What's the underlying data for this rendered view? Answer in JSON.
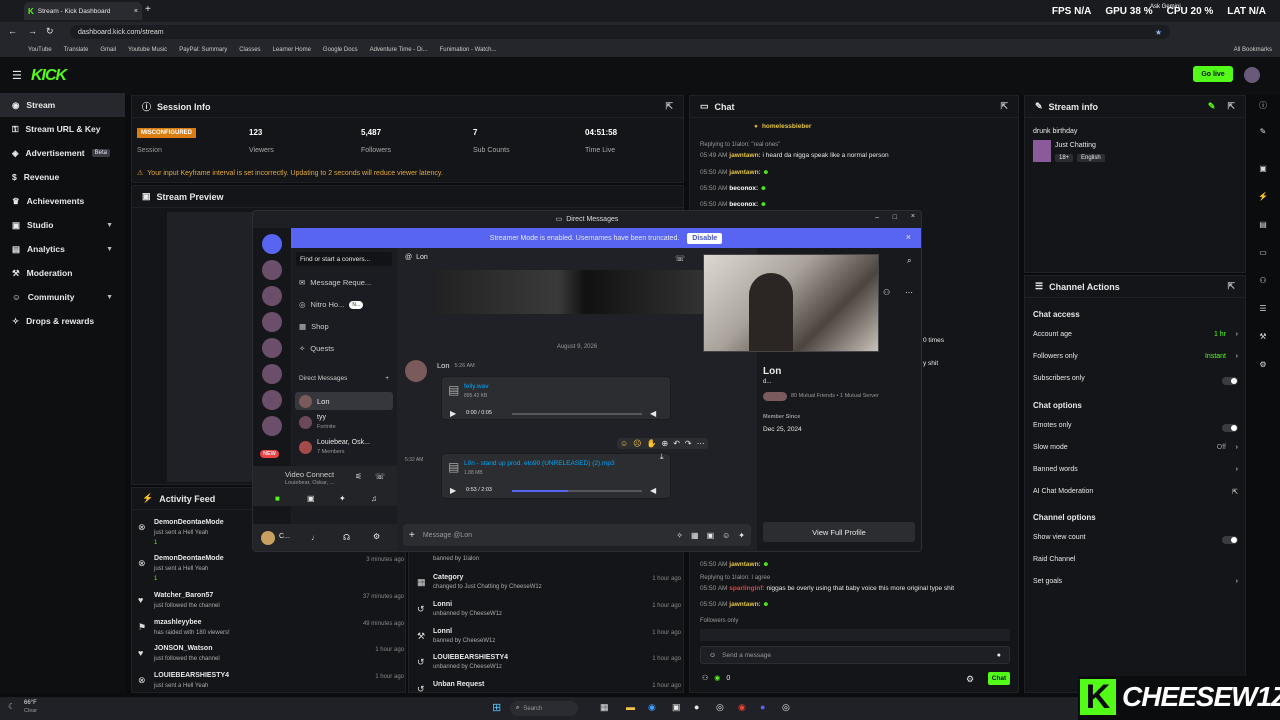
{
  "browser": {
    "tab_title": "Stream - Kick Dashboard",
    "url": "dashboard.kick.com/stream",
    "bookmarks": [
      "YouTube",
      "Translate",
      "Gmail",
      "Youtube Music",
      "PayPal: Summary",
      "Classes",
      "Learner Home",
      "Google Docs",
      "Adventure Time - Di...",
      "Funimation - Watch..."
    ],
    "all_bookmarks": "All Bookmarks"
  },
  "overlay": {
    "fps": "FPS N/A",
    "gpu": "GPU 38 %",
    "cpu": "CPU 20 %",
    "lat": "LAT N/A",
    "ask": "Ask Gemini"
  },
  "kick": {
    "logo": "KICK",
    "go_live": "Go live"
  },
  "sidebar": {
    "items": [
      {
        "label": "Stream",
        "icon": "broadcast-icon"
      },
      {
        "label": "Stream URL & Key",
        "icon": "key-icon"
      },
      {
        "label": "Advertisement",
        "badge": "Beta",
        "icon": "megaphone-icon"
      },
      {
        "label": "Revenue",
        "icon": "dollar-icon"
      },
      {
        "label": "Achievements",
        "icon": "trophy-icon"
      },
      {
        "label": "Studio",
        "icon": "studio-icon"
      },
      {
        "label": "Analytics",
        "icon": "chart-icon"
      },
      {
        "label": "Moderation",
        "icon": "hammer-icon"
      },
      {
        "label": "Community",
        "icon": "people-icon"
      },
      {
        "label": "Drops & rewards",
        "icon": "gift-icon"
      }
    ]
  },
  "session": {
    "title": "Session Info",
    "badge": "MISCONFIGURED",
    "session_label": "Session",
    "viewers": "123",
    "viewers_label": "Viewers",
    "followers": "5,487",
    "followers_label": "Followers",
    "subs": "7",
    "subs_label": "Sub Counts",
    "time": "04:51:58",
    "time_label": "Time Live",
    "warning": "Your input Keyframe interval is set incorrectly. Updating to 2 seconds will reduce viewer latency."
  },
  "preview": {
    "title": "Stream Preview"
  },
  "activity": {
    "title": "Activity Feed",
    "rows": [
      {
        "name": "DemonDeontaeMode",
        "desc": "just sent a Hell Yeah",
        "time": "",
        "count": "1"
      },
      {
        "name": "DemonDeontaeMode",
        "desc": "just sent a Hell Yeah",
        "time": "3 minutes ago",
        "count": "1"
      },
      {
        "name": "Watcher_Baron57",
        "desc": "just followed the channel",
        "time": "37 minutes ago"
      },
      {
        "name": "mzashleyybee",
        "desc": "has raided with 180 viewers!",
        "time": "49 minutes ago"
      },
      {
        "name": "JONSON_Watson",
        "desc": "just followed the channel",
        "time": "1 hour ago"
      },
      {
        "name": "LOUIEBEARSHIESTY4",
        "desc": "just sent a Hell Yeah",
        "time": "1 hour ago"
      }
    ]
  },
  "modlog": {
    "rows": [
      {
        "name": "banned by 1Ialon",
        "desc": "",
        "time": ""
      },
      {
        "name": "Category",
        "desc": "changed to Just Chatting by CheeseW1z",
        "time": "1 hour ago"
      },
      {
        "name": "Lonni",
        "desc": "unbanned by CheeseW1z",
        "time": "1 hour ago"
      },
      {
        "name": "Lonnl",
        "desc": "banned by CheeseW1z",
        "time": "1 hour ago"
      },
      {
        "name": "LOUIEBEARSHIESTY4",
        "desc": "unbanned by CheeseW1z",
        "time": "1 hour ago"
      },
      {
        "name": "Unban Request",
        "desc": "",
        "time": "1 hour ago"
      }
    ]
  },
  "chat": {
    "title": "Chat",
    "pinned": "homelessbieber",
    "lines": [
      {
        "meta": "Replying to 1Ialon: \"real ones\"",
        "time": "05:49 AM",
        "user": "jawntawn:",
        "msg": "i heard da nigga speak like a normal person"
      },
      {
        "time": "05:50 AM",
        "user": "jawntawn:",
        "msg": ""
      },
      {
        "time": "05:50 AM",
        "user": "beconox:",
        "msg": ""
      },
      {
        "time": "05:50 AM",
        "user": "beconox:",
        "msg": ""
      }
    ],
    "partial1": "0 times",
    "partial2": "y shit",
    "lower": [
      {
        "time": "05:50 AM",
        "user": "jawntawn:",
        "msg": ""
      },
      {
        "meta": "Replying to 1Ialon: I agree",
        "time": "05:50 AM",
        "user": "sparlinginf:",
        "msg": "niggas be overly using that baby voice this more original type shit"
      },
      {
        "time": "05:50 AM",
        "user": "jawntawn:",
        "msg": ""
      }
    ],
    "followers_only": "Followers only",
    "placeholder": "Send a message",
    "count": "0",
    "send": "Chat"
  },
  "stream_info": {
    "title": "Stream info",
    "stream_title": "drunk birthday",
    "category": "Just Chatting",
    "tag1": "18+",
    "tag2": "English"
  },
  "channel_actions": {
    "title": "Channel Actions",
    "chat_access": "Chat access",
    "account_age": "Account age",
    "account_age_val": "1 hr",
    "followers_only": "Followers only",
    "followers_only_val": "Instant",
    "subscribers_only": "Subscribers only",
    "chat_options": "Chat options",
    "emotes_only": "Emotes only",
    "slow_mode": "Slow mode",
    "slow_mode_val": "Off",
    "banned_words": "Banned words",
    "ai_mod": "AI Chat Moderation",
    "channel_options": "Channel options",
    "show_view_count": "Show view count",
    "raid_channel": "Raid Channel",
    "set_goals": "Set goals"
  },
  "discord": {
    "window_title": "Direct Messages",
    "streamer_mode": "Streamer Mode is enabled. Usernames have been truncated.",
    "disable": "Disable",
    "search": "Find or start a convers...",
    "message_requests": "Message Reque...",
    "nitro": "Nitro Ho...",
    "nitro_badge": "N...",
    "shop": "Shop",
    "quests": "Quests",
    "dm_header": "Direct Messages",
    "dm_users": [
      {
        "name": "Lon",
        "sub": ""
      },
      {
        "name": "tyy",
        "sub": "Fortnite"
      },
      {
        "name": "Louiebear, Osk...",
        "sub": "7 Members"
      }
    ],
    "voice": "Video Connect",
    "voice_sub": "Louiebear, Oskar, ...",
    "new_badge": "NEW",
    "user_short": "C...",
    "chat_user": "Lon",
    "date_divider": "August 9, 2026",
    "msg_user": "Lon",
    "msg_time": "5:26 AM",
    "file1": "felly.wav",
    "file1_size": "895.42 KB",
    "file1_time": "0:00 / 0:05",
    "time2": "5:32 AM",
    "file2": "L0n - stand up prod. eto90 (UNRELEASED) (2).mp3",
    "file2_size": "1.88 MB",
    "file2_time": "0:53 / 2:03",
    "file2_progress": 0.43,
    "placeholder": "Message @Lon",
    "profile_name": "Lon",
    "profile_sub": "d...",
    "mutual": "80 Mutual Friends • 1 Mutual Server",
    "member_since_label": "Member Since",
    "member_since": "Dec 25, 2024",
    "view_profile": "View Full Profile"
  },
  "brand": {
    "k": "K",
    "name": "CHEESEW1Z"
  },
  "taskbar": {
    "weather_temp": "66°F",
    "weather_desc": "Clear",
    "search": "Search"
  },
  "colors": {
    "kick_green": "#53fc18",
    "discord_blurple": "#5865f2",
    "warning": "#e2a93b"
  }
}
